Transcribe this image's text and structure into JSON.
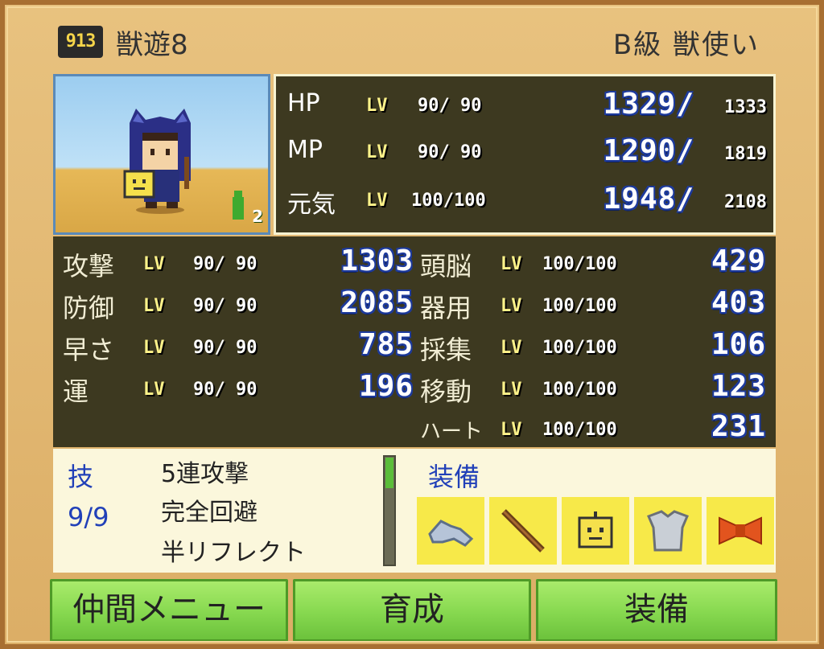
{
  "header": {
    "badge": "913",
    "name": "獣遊8",
    "rank": "B級 獣使い"
  },
  "portrait": {
    "level_badge": "2"
  },
  "colors": {
    "accent_blue": "#2140b8",
    "button_green": "#86d84f",
    "panel_dark": "#3d3920",
    "equip_slot": "#f7e949"
  },
  "vitals": [
    {
      "label": "HP",
      "lv": "LV",
      "lv_value": "90/ 90",
      "current": "1329/",
      "max": "1333"
    },
    {
      "label": "MP",
      "lv": "LV",
      "lv_value": "90/ 90",
      "current": "1290/",
      "max": "1819"
    },
    {
      "label": "元気",
      "lv": "LV",
      "lv_value": "100/100",
      "current": "1948/",
      "max": "2108"
    }
  ],
  "stats_left": [
    {
      "label": "攻撃",
      "lv": "LV",
      "lv_value": "90/ 90",
      "value": "1303"
    },
    {
      "label": "防御",
      "lv": "LV",
      "lv_value": "90/ 90",
      "value": "2085"
    },
    {
      "label": "早さ",
      "lv": "LV",
      "lv_value": "90/ 90",
      "value": "785"
    },
    {
      "label": "運",
      "lv": "LV",
      "lv_value": "90/ 90",
      "value": "196"
    }
  ],
  "stats_right": [
    {
      "label": "頭脳",
      "lv": "LV",
      "lv_value": "100/100",
      "value": "429"
    },
    {
      "label": "器用",
      "lv": "LV",
      "lv_value": "100/100",
      "value": "403"
    },
    {
      "label": "採集",
      "lv": "LV",
      "lv_value": "100/100",
      "value": "106"
    },
    {
      "label": "移動",
      "lv": "LV",
      "lv_value": "100/100",
      "value": "123"
    },
    {
      "label": "ハート",
      "lv": "LV",
      "lv_value": "100/100",
      "value": "231"
    }
  ],
  "skills": {
    "heading": "技",
    "count": "9/9",
    "items": [
      "5連攻撃",
      "完全回避",
      "半リフレクト"
    ]
  },
  "equipment": {
    "heading": "装備",
    "slots": [
      "gauntlet-icon",
      "staff-icon",
      "robot-face-icon",
      "chestplate-icon",
      "bow-ribbon-icon"
    ]
  },
  "buttons": {
    "party_menu": "仲間メニュー",
    "train": "育成",
    "equip": "装備"
  }
}
